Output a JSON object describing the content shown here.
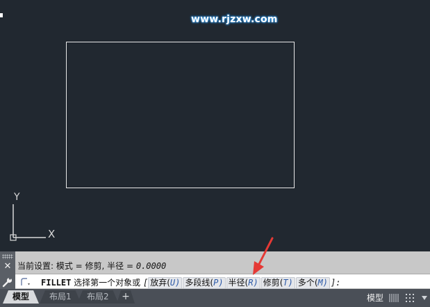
{
  "watermark": "www.rjzxw.com",
  "ucs": {
    "y_label": "Y",
    "x_label": "X"
  },
  "command": {
    "history": "当前设置: 模式 = 修剪, 半径 = ",
    "history_value": "0.0000",
    "name": "FILLET",
    "prompt": " 选择第一个对象或 ",
    "bracket_open": "[",
    "bracket_close": "]:",
    "options": [
      {
        "label": "放弃(",
        "key": "U",
        "close": ")"
      },
      {
        "label": "多段线(",
        "key": "P",
        "close": ")"
      },
      {
        "label": "半径(",
        "key": "R",
        "close": ")"
      },
      {
        "label": "修剪(",
        "key": "T",
        "close": ")"
      },
      {
        "label": "多个(",
        "key": "M",
        "close": ")"
      }
    ]
  },
  "tabs": [
    {
      "label": "模型",
      "active": true
    },
    {
      "label": "布局1",
      "active": false
    },
    {
      "label": "布局2",
      "active": false
    }
  ],
  "add_tab": "+",
  "status": {
    "model": "模型"
  },
  "icons": {
    "close": "close-icon",
    "wrench": "wrench-icon",
    "command": "fillet-command-icon",
    "grid": "grid-icon",
    "snap": "snap-icon",
    "menu": "chevron-down-icon"
  },
  "colors": {
    "canvas": "#212830",
    "annotation": "#e53935",
    "option_key": "#2c5aa8"
  }
}
